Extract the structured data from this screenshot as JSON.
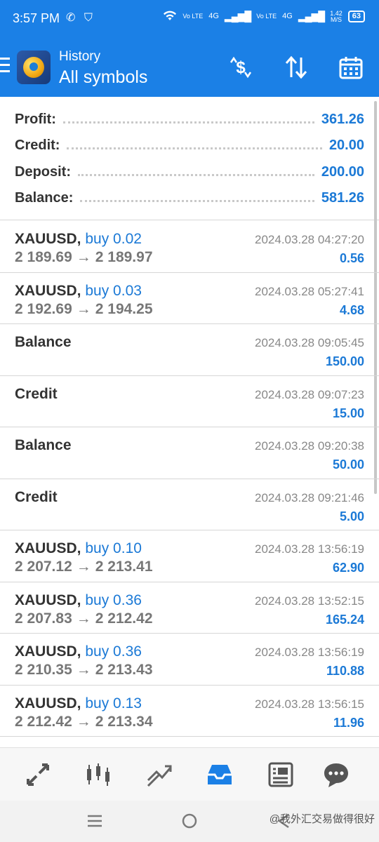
{
  "status_bar": {
    "time": "3:57 PM",
    "icons": [
      "whatsapp-icon",
      "shield-check-icon"
    ],
    "net1": "Vo LTE",
    "net1_gen": "4G",
    "net2": "Vo LTE",
    "net2_gen": "4G",
    "speed": "1.42",
    "speed_unit": "M/S",
    "battery": "63"
  },
  "header": {
    "subtitle": "History",
    "title": "All symbols",
    "actions": [
      "currency-exchange-icon",
      "sort-icon",
      "calendar-icon"
    ]
  },
  "summary": [
    {
      "label": "Profit:",
      "value": "361.26"
    },
    {
      "label": "Credit:",
      "value": "20.00"
    },
    {
      "label": "Deposit:",
      "value": "200.00"
    },
    {
      "label": "Balance:",
      "value": "581.26"
    }
  ],
  "rows": [
    {
      "symbol": "XAUUSD,",
      "side": "buy 0.02",
      "open": "2 189.69",
      "arrow": "→",
      "close": "2 189.97",
      "date": "2024.03.28 04:27:20",
      "amount": "0.56"
    },
    {
      "symbol": "XAUUSD,",
      "side": "buy 0.03",
      "open": "2 192.69",
      "arrow": "→",
      "close": "2 194.25",
      "date": "2024.03.28 05:27:41",
      "amount": "4.68"
    },
    {
      "symbol": "Balance",
      "side": "",
      "open": "",
      "arrow": "",
      "close": "",
      "date": "2024.03.28 09:05:45",
      "amount": "150.00"
    },
    {
      "symbol": "Credit",
      "side": "",
      "open": "",
      "arrow": "",
      "close": "",
      "date": "2024.03.28 09:07:23",
      "amount": "15.00"
    },
    {
      "symbol": "Balance",
      "side": "",
      "open": "",
      "arrow": "",
      "close": "",
      "date": "2024.03.28 09:20:38",
      "amount": "50.00"
    },
    {
      "symbol": "Credit",
      "side": "",
      "open": "",
      "arrow": "",
      "close": "",
      "date": "2024.03.28 09:21:46",
      "amount": "5.00"
    },
    {
      "symbol": "XAUUSD,",
      "side": "buy 0.10",
      "open": "2 207.12",
      "arrow": "→",
      "close": "2 213.41",
      "date": "2024.03.28 13:56:19",
      "amount": "62.90"
    },
    {
      "symbol": "XAUUSD,",
      "side": "buy 0.36",
      "open": "2 207.83",
      "arrow": "→",
      "close": "2 212.42",
      "date": "2024.03.28 13:52:15",
      "amount": "165.24"
    },
    {
      "symbol": "XAUUSD,",
      "side": "buy 0.36",
      "open": "2 210.35",
      "arrow": "→",
      "close": "2 213.43",
      "date": "2024.03.28 13:56:19",
      "amount": "110.88"
    },
    {
      "symbol": "XAUUSD,",
      "side": "buy 0.13",
      "open": "2 212.42",
      "arrow": "→",
      "close": "2 213.34",
      "date": "2024.03.28 13:56:15",
      "amount": "11.96"
    }
  ],
  "tabs": [
    "quotes-icon",
    "chart-icon",
    "trade-icon",
    "history-icon",
    "news-icon",
    "chat-icon"
  ],
  "active_tab": "history-icon",
  "nav": {
    "buttons": [
      "recents-icon",
      "home-icon",
      "back-icon"
    ],
    "watermark": "@我外汇交易做得很好"
  },
  "colors": {
    "primary": "#1b80e6",
    "value_blue": "#1b79d6",
    "text_dark": "#333333",
    "text_muted": "#888888"
  }
}
